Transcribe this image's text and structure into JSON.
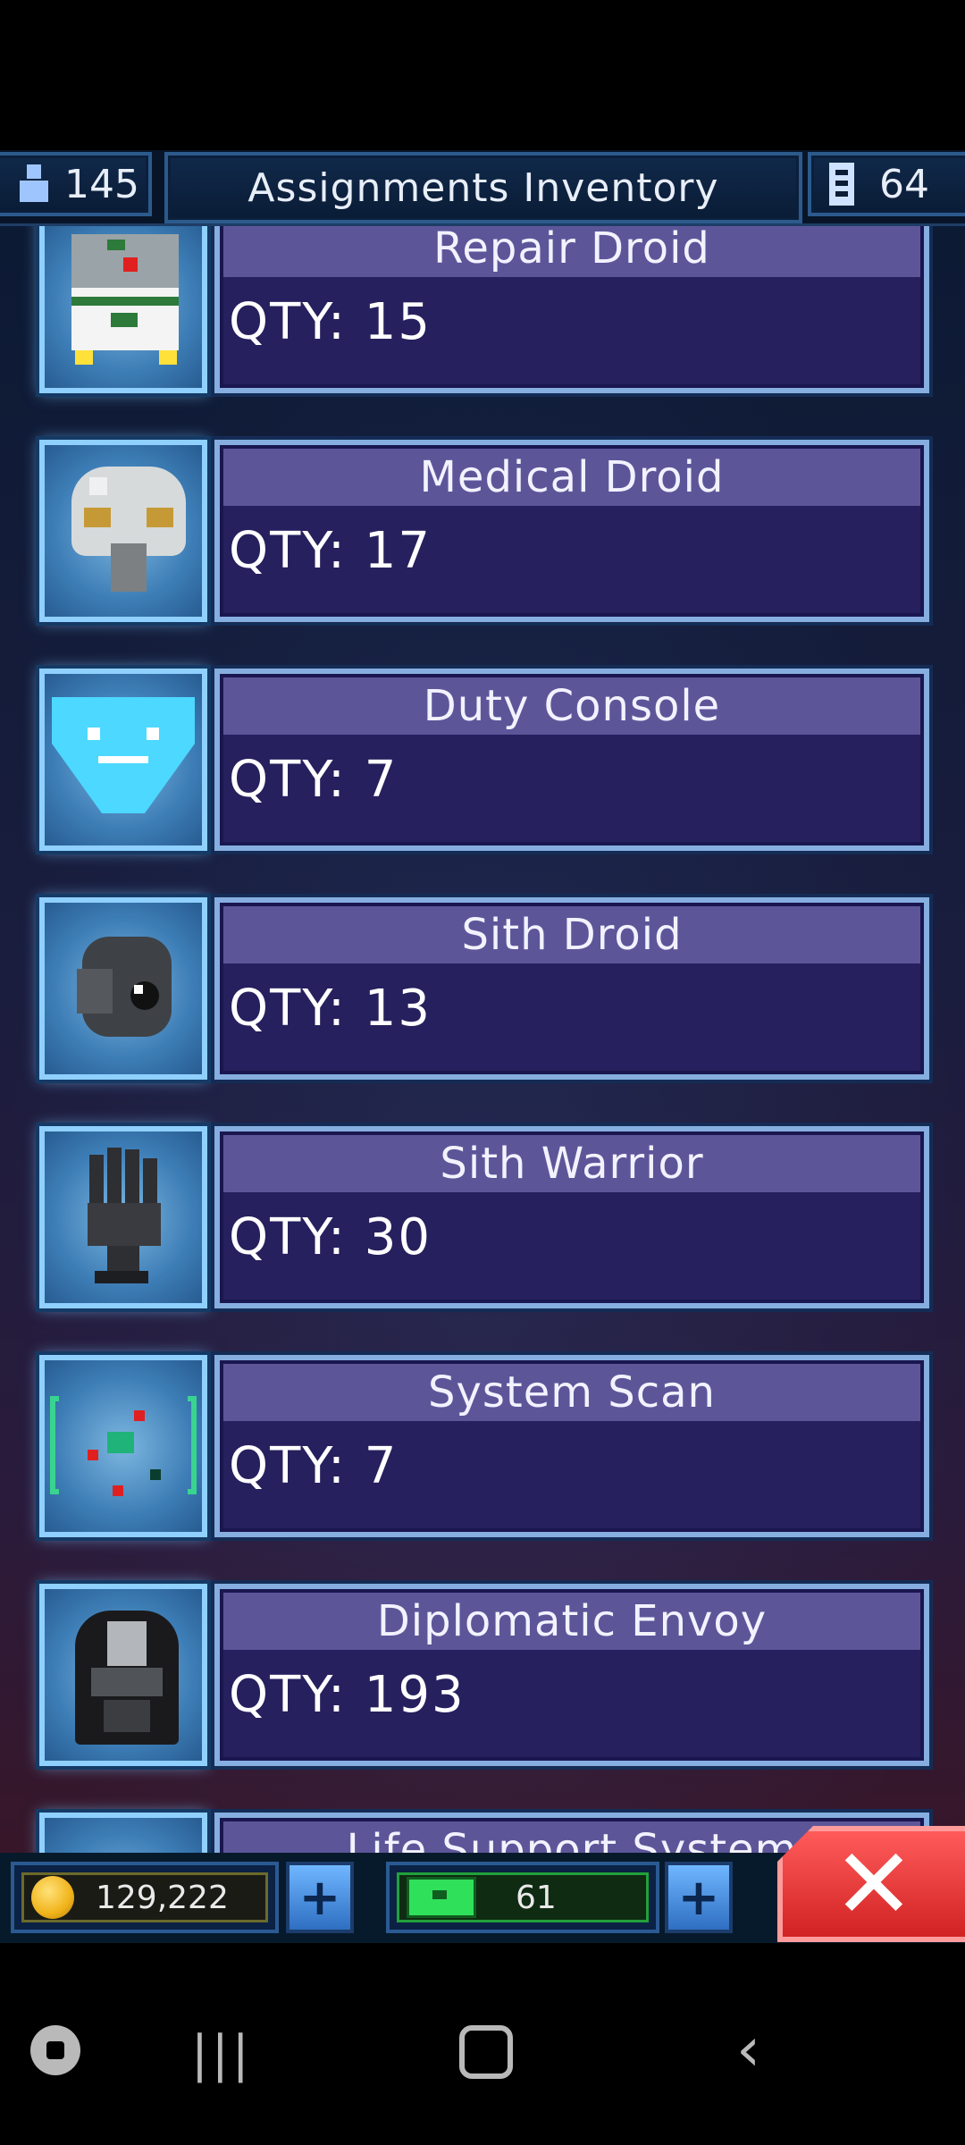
{
  "header": {
    "population": "145",
    "title": "Assignments Inventory",
    "floors": "64"
  },
  "items": [
    {
      "name": "Repair Droid",
      "qty": "QTY: 15",
      "icon": "repair-droid-icon"
    },
    {
      "name": "Medical Droid",
      "qty": "QTY: 17",
      "icon": "medical-droid-icon"
    },
    {
      "name": "Duty Console",
      "qty": "QTY: 7",
      "icon": "duty-console-icon"
    },
    {
      "name": "Sith Droid",
      "qty": "QTY: 13",
      "icon": "sith-droid-icon"
    },
    {
      "name": "Sith Warrior",
      "qty": "QTY: 30",
      "icon": "sith-warrior-icon"
    },
    {
      "name": "System Scan",
      "qty": "QTY: 7",
      "icon": "system-scan-icon"
    },
    {
      "name": "Diplomatic Envoy",
      "qty": "QTY: 193",
      "icon": "diplomatic-envoy-icon"
    },
    {
      "name": "Life Support System",
      "qty": "",
      "icon": "life-support-icon"
    }
  ],
  "footer": {
    "coins": "129,222",
    "energy": "61",
    "plus_label": "+",
    "close_label": "✕"
  },
  "colors": {
    "panel": "#26205e",
    "name_bar": "#5c5699",
    "thumb_border": "#8fd0ff",
    "close": "#e03030",
    "energy": "#2fe05a"
  }
}
